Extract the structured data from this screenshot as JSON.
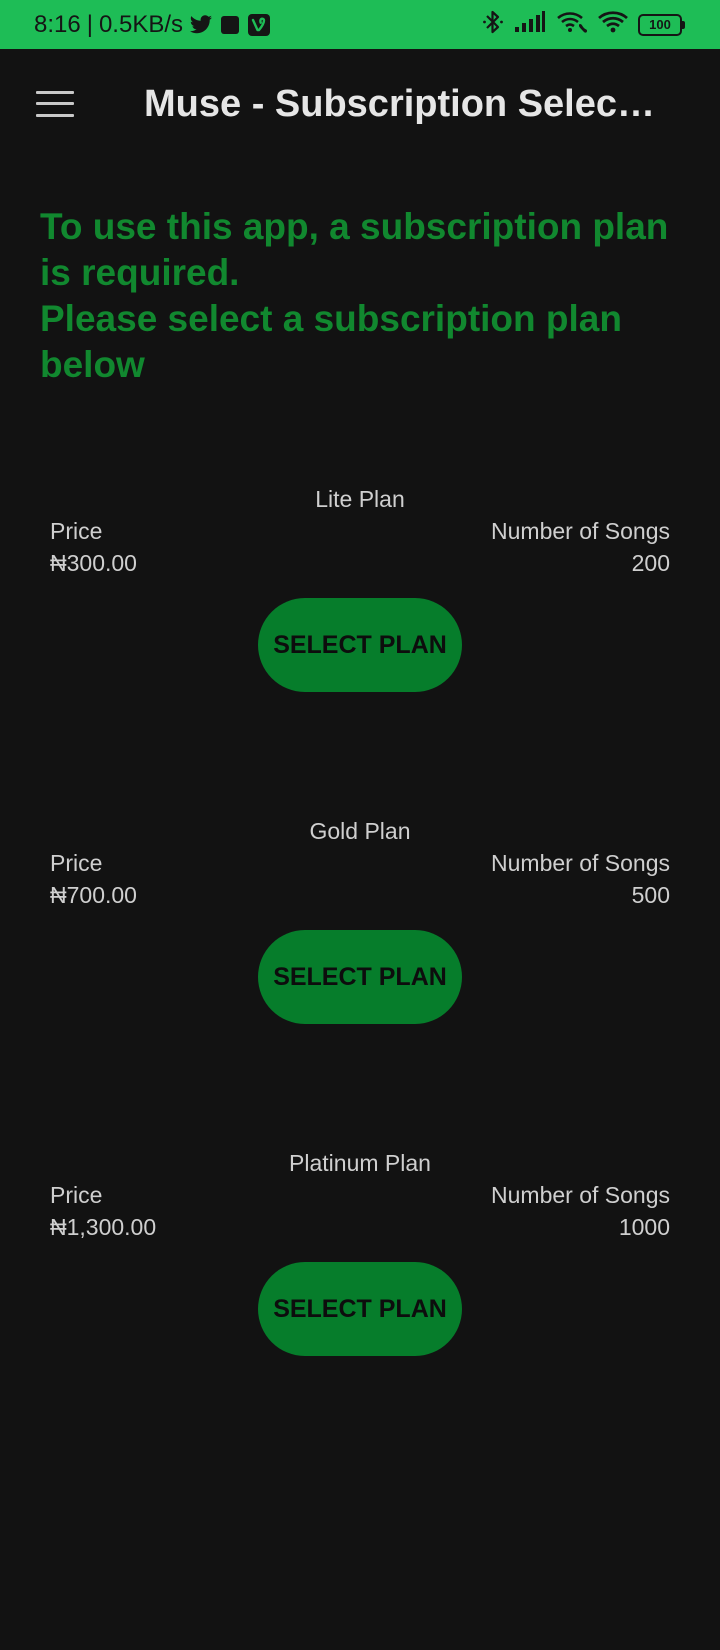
{
  "status_bar": {
    "time": "8:16",
    "separator": "|",
    "net_speed": "0.5KB/s",
    "battery": "100",
    "icons": [
      "twitter-icon",
      "square-icon",
      "vine-icon",
      "bluetooth-icon",
      "signal-icon",
      "wifi-calling-icon",
      "wifi-icon",
      "battery-icon"
    ]
  },
  "app_bar": {
    "title": "Muse - Subscription Selecti…"
  },
  "notice": {
    "line1": "To use this app, a subscription plan is required.",
    "line2": "Please select a subscription plan below"
  },
  "plans": [
    {
      "name": "Lite Plan",
      "price_label": "Price",
      "price": "₦300.00",
      "songs_label": "Number of Songs",
      "songs": "200",
      "button": "SELECT PLAN"
    },
    {
      "name": "Gold Plan",
      "price_label": "Price",
      "price": "₦700.00",
      "songs_label": "Number of Songs",
      "songs": "500",
      "button": "SELECT PLAN"
    },
    {
      "name": "Platinum Plan",
      "price_label": "Price",
      "price": "₦1,300.00",
      "songs_label": "Number of Songs",
      "songs": "1000",
      "button": "SELECT PLAN"
    }
  ],
  "colors": {
    "status_bar": "#1ebd56",
    "background": "#121212",
    "accent_text": "#11882f",
    "button": "#067d2b"
  }
}
